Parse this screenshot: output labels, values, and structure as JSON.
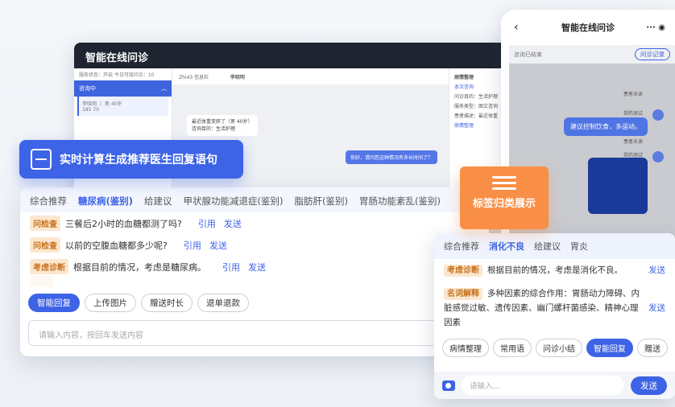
{
  "desktop": {
    "title": "智能在线问诊",
    "status": "服务状态：开启    今日可接问诊：10",
    "selected": "咨询中",
    "patient_line": "李晓明 丨 男 40岁",
    "patient_extra": "185  70",
    "chat_header": "Zhi43  信息栏",
    "chat_user": "李晓明",
    "bubble_left_1": "最近体重变胖了（男 40岁）",
    "bubble_left_2": "咨询目的：生活护理",
    "bubble_right": "你好，请问您这种情况有多长时间了？",
    "right_title": "病情整理",
    "right_section": "本次咨询",
    "right_items": [
      "问诊目的：生活护理",
      "服务类型：图文咨询",
      "患者描述：最近体重"
    ],
    "right_section2": "病情整理"
  },
  "badge_blue": {
    "label": "实时计算生成推荐医生回复语句"
  },
  "recommend": {
    "tabs": [
      "综合推荐",
      "糖尿病(鉴别)",
      "给建议",
      "甲状腺功能减退症(鉴别)",
      "脂肪肝(鉴别)",
      "胃肠功能紊乱(鉴别)"
    ],
    "rows": [
      {
        "tag": "问检查",
        "text": "三餐后2小时的血糖都测了吗?",
        "quote": "引用",
        "send": "发送"
      },
      {
        "tag": "问检查",
        "text": "以前的空腹血糖都多少呢?",
        "quote": "引用",
        "send": "发送"
      },
      {
        "tag": "考虑诊断",
        "text": "根据目前的情况，考虑是糖尿病。",
        "quote": "引用",
        "send": "发送"
      }
    ],
    "chips": [
      "智能回复",
      "上传图片",
      "赠送时长",
      "退单退款"
    ],
    "input_placeholder": "请输入内容，按回车发送内容"
  },
  "phone": {
    "title": "智能在线问诊",
    "consult_done": "咨询已结束",
    "record_btn": "问诊记录",
    "reply_1": "建议控制饮食，多运动。",
    "patient_note": "患者未读",
    "doctor_name": "郑药测试"
  },
  "badge_orange": {
    "label": "标签归类展示"
  },
  "tag_card": {
    "tabs": [
      "综合推荐",
      "消化不良",
      "给建议",
      "胃炎"
    ],
    "rows": [
      {
        "tag": "考虑诊断",
        "text": "根据目前的情况，考虑是消化不良。",
        "send": "发送"
      },
      {
        "tag": "名词解释",
        "text": "多种因素的综合作用：胃肠动力障碍、内脏感觉过敏、遗传因素、幽门螺杆菌感染、精神心理因素",
        "send": "发送"
      }
    ],
    "chips": [
      "病情整理",
      "常用语",
      "问诊小结",
      "智能回复",
      "赠送"
    ],
    "input_placeholder": "请输入...",
    "send": "发送"
  }
}
